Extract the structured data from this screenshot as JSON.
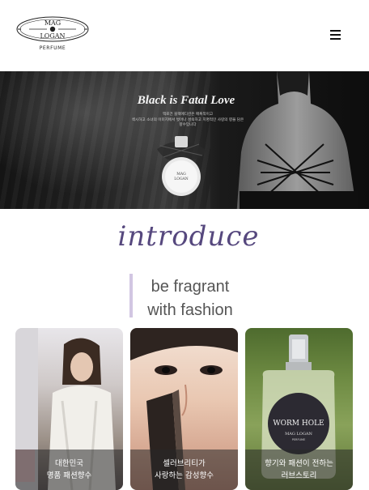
{
  "header": {
    "logo": {
      "line1": "MAG",
      "line2": "LOGAN",
      "sub": "PERFUME"
    },
    "menu_icon": "hamburger-menu-icon"
  },
  "hero": {
    "title": "Black is Fatal Love",
    "subtitle_lines": [
      "맥로건 블랙에디션은 매혹적이고",
      "섹시하고 소녀의 이미지에서 벗어나 성숙하고 치명적인 사랑의 향을 담은 향수입니다"
    ],
    "bottle_label": {
      "line1": "MAG",
      "line2": "LOGAN"
    }
  },
  "intro": {
    "title": "introduce",
    "slogan": [
      "be fragrant",
      "with fashion"
    ]
  },
  "cards": [
    {
      "line1": "대한민국",
      "line2": "명품 패션향수"
    },
    {
      "line1": "셀러브리티가",
      "line2": "사랑하는 감성향수"
    },
    {
      "line1": "향기와 패션이 전하는",
      "line2": "러브스토리",
      "bottle_text1": "WORM HOLE",
      "bottle_text2": "MAG LOGAN",
      "bottle_text3": "PERFUME"
    }
  ],
  "colors": {
    "accent": "#56487e",
    "slogan_bar": "#d2c6e2"
  }
}
